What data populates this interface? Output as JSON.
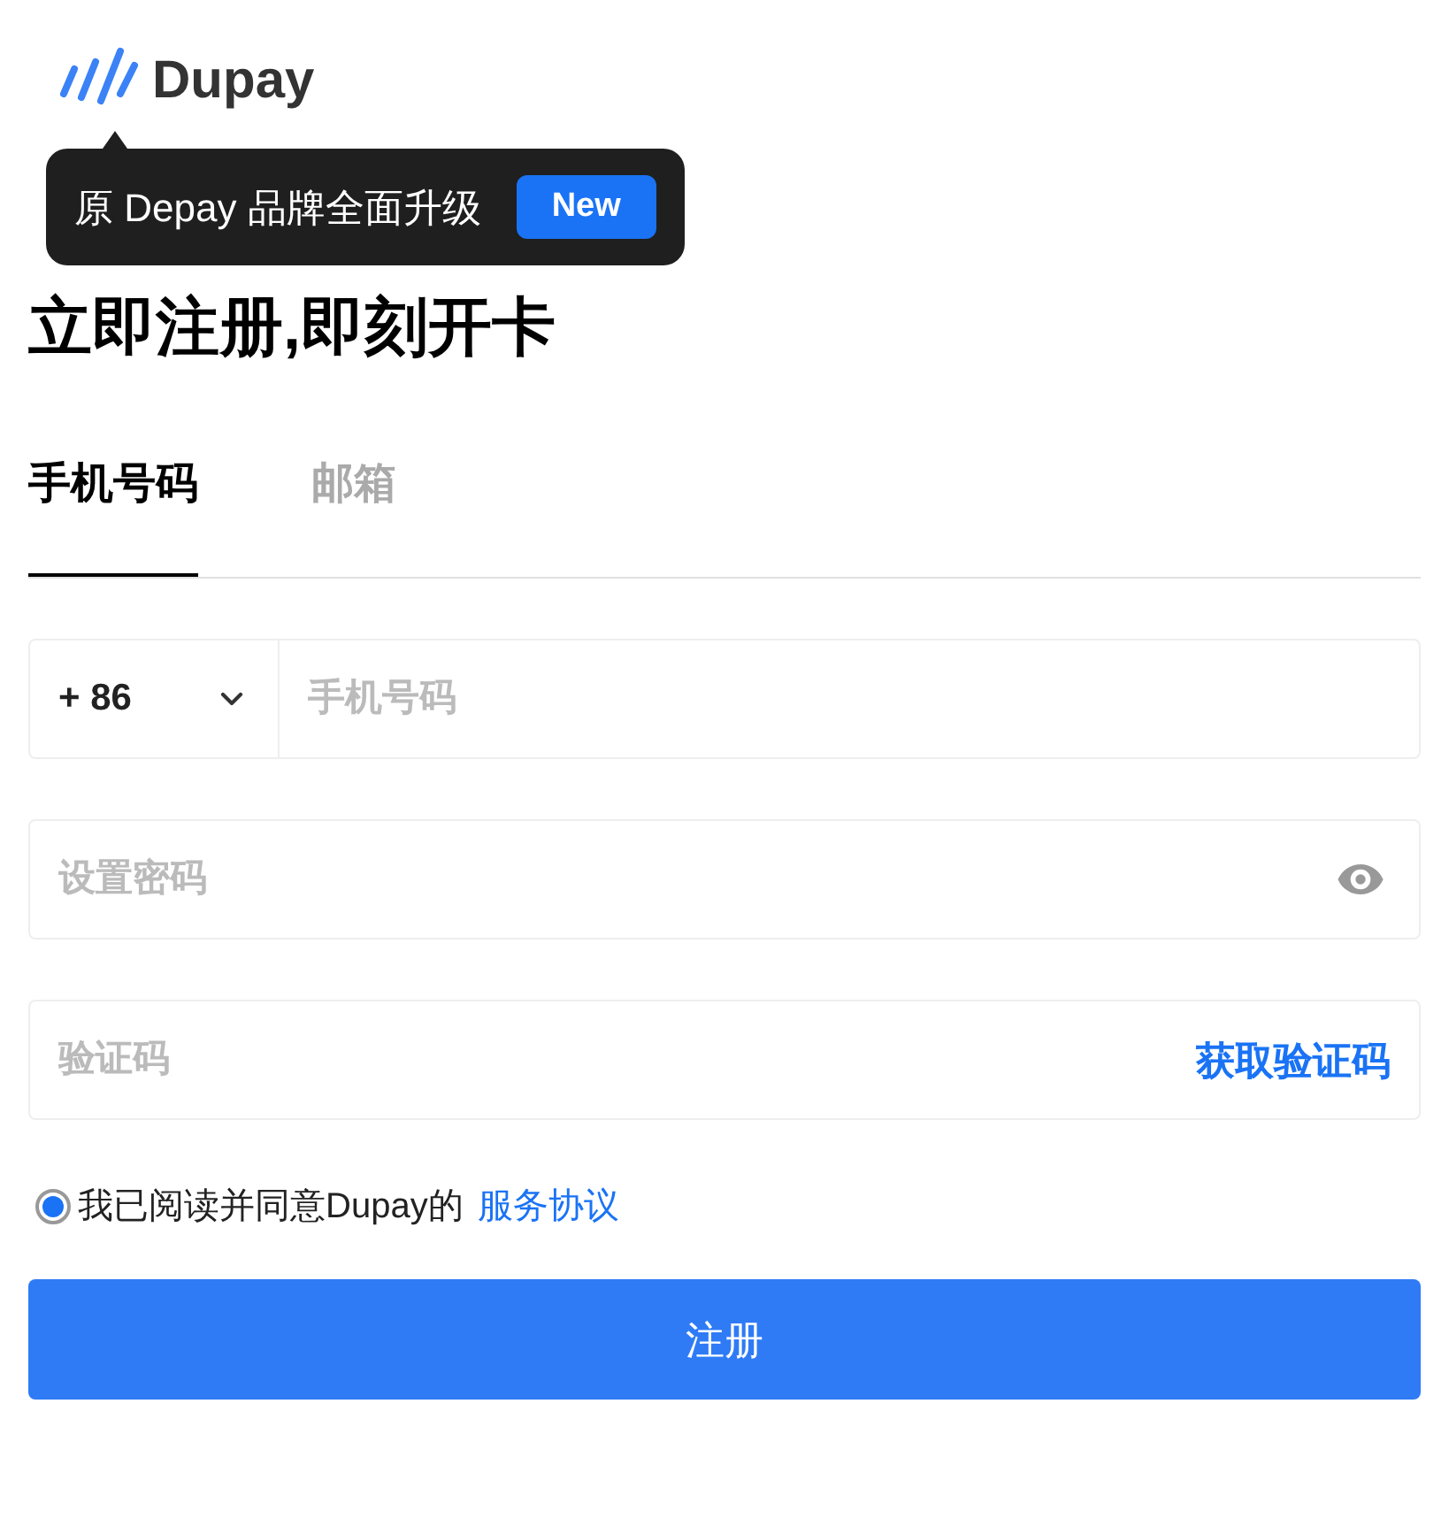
{
  "logo": {
    "text": "Dupay"
  },
  "tooltip": {
    "text": "原 Depay 品牌全面升级",
    "badge": "New"
  },
  "heading": "立即注册,即刻开卡",
  "tabs": [
    {
      "label": "手机号码",
      "selected": true
    },
    {
      "label": "邮箱",
      "selected": false
    }
  ],
  "phone": {
    "country_code": "+ 86",
    "placeholder": "手机号码"
  },
  "password": {
    "placeholder": "设置密码"
  },
  "code": {
    "placeholder": "验证码",
    "action": "获取验证码"
  },
  "agreement": {
    "checked": true,
    "text": "我已阅读并同意Dupay的",
    "link": "服务协议"
  },
  "submit": "注册"
}
